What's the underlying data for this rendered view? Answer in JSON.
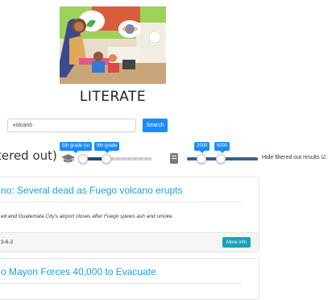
{
  "brand": {
    "name": "LITERATE"
  },
  "search": {
    "value": "volcano",
    "button_label": "Search"
  },
  "filters": {
    "partial_label": "tered out)",
    "grade_slider": {
      "low_label": "5th grade (or",
      "high_label": "8th grade"
    },
    "length_slider": {
      "low_label": "2000",
      "high_label": "5000"
    },
    "hide_filtered_label": "Hide filtered out results ☑"
  },
  "results": [
    {
      "title": "no: Several dead as Fuego volcano erupts",
      "description": "ed and Guatemala City's airport closes after Fuego spews ash and smoke.",
      "date": "3-6-3",
      "more_label": "More info"
    },
    {
      "title": "o Mayon Forces 40,000 to Evacuate"
    }
  ],
  "colors": {
    "accent": "#1a8cff",
    "title_link": "#1aa1e0",
    "slider_fill": "#1f4e79",
    "info_button": "#17a2b8"
  }
}
